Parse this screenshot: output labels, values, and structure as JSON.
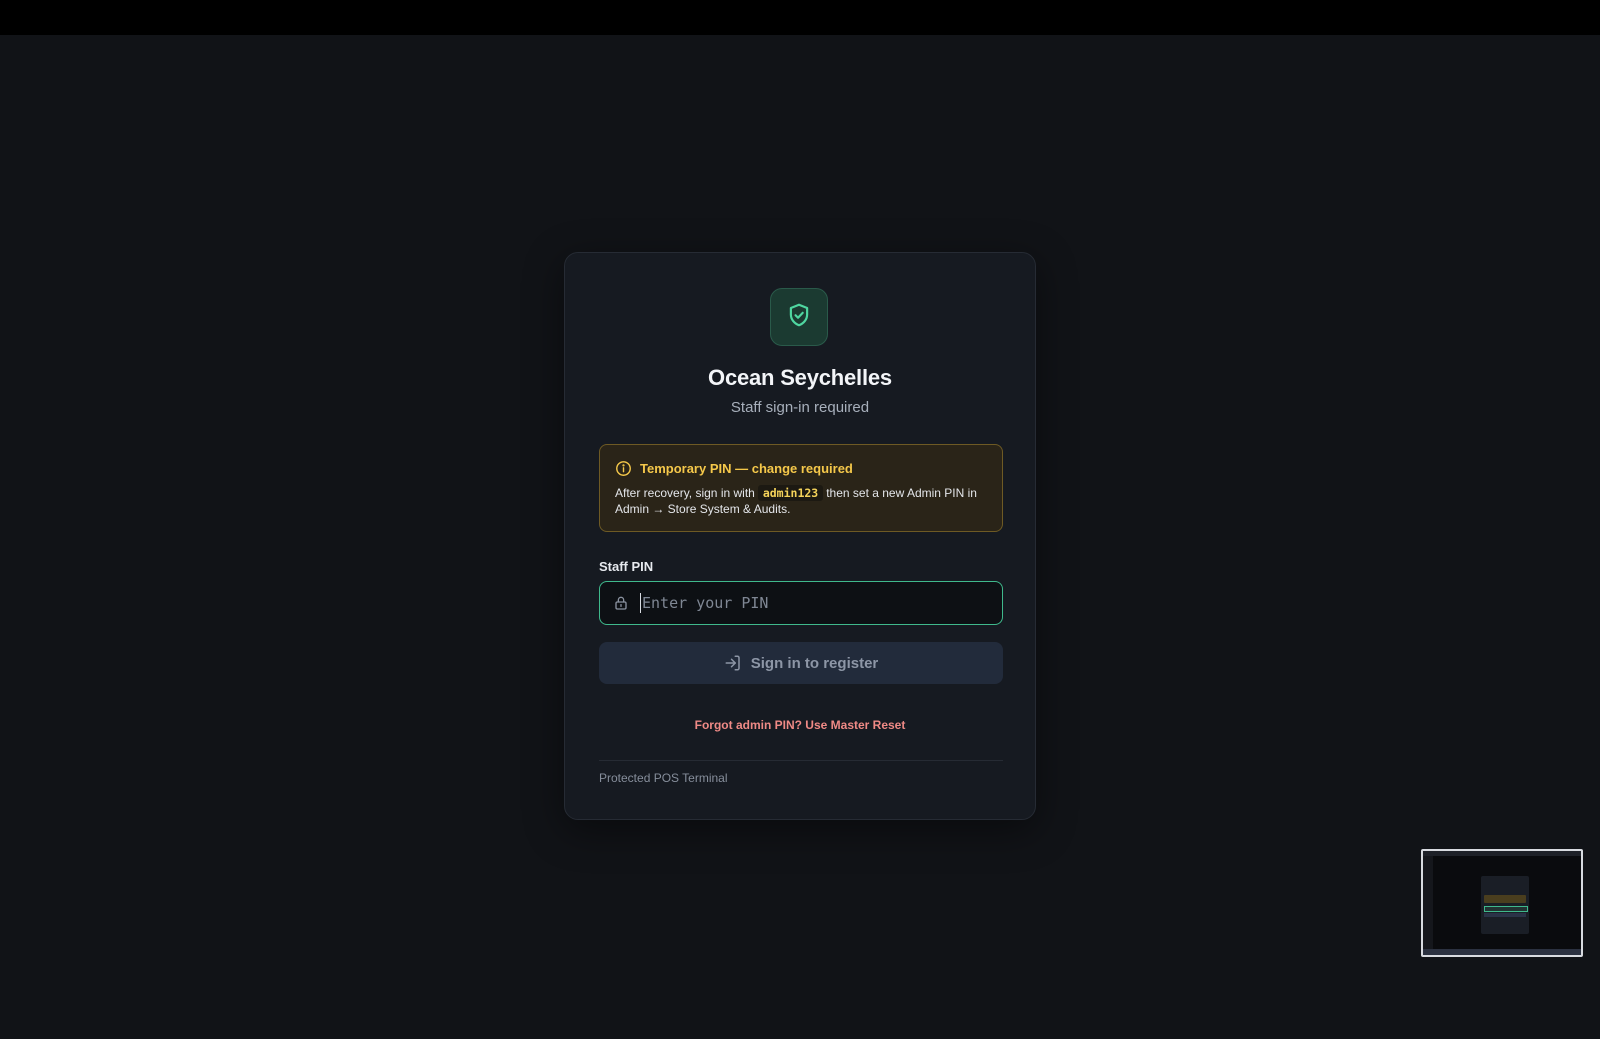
{
  "app": {
    "name": "Ocean Seychelles",
    "subtitle": "Staff sign-in required"
  },
  "icons": {
    "brand": "shield-check-icon",
    "alert": "info-circle-icon",
    "field": "lock-icon",
    "button": "sign-in-icon"
  },
  "alert": {
    "title": "Temporary PIN — change required",
    "body_before": "After recovery, sign in with",
    "code": "admin123",
    "body_after": "then set a new Admin PIN in Admin → Store System & Audits."
  },
  "pin": {
    "label": "Staff PIN",
    "placeholder": "Enter your PIN",
    "value": ""
  },
  "signin": {
    "label": "Sign in to register"
  },
  "forgot": {
    "label": "Forgot admin PIN? Use Master Reset"
  },
  "footer": {
    "text": "Protected POS Terminal"
  },
  "colors": {
    "background": "#111317",
    "card": "#161a21",
    "accent": "#3fb98c",
    "warning": "#f5c84a",
    "danger_link": "#ef8a86"
  }
}
